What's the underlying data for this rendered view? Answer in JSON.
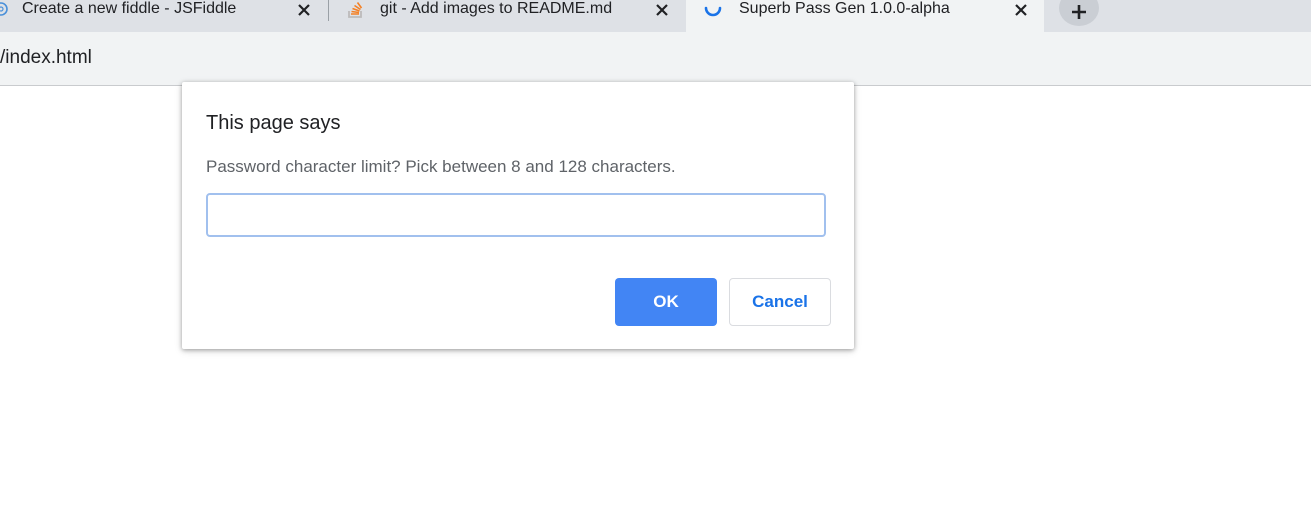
{
  "browser": {
    "tabs": [
      {
        "title": "Create a new fiddle - JSFiddle",
        "favicon": "jsfiddle-icon",
        "active": false
      },
      {
        "title": "git - Add images to README.md",
        "favicon": "stackoverflow-icon",
        "active": false
      },
      {
        "title": "Superb Pass Gen 1.0.0-alpha",
        "favicon": "loading-spinner-icon",
        "active": true
      }
    ],
    "close_glyph": "✕",
    "new_tab_glyph": "+",
    "address": "/index.html"
  },
  "dialog": {
    "title": "This page says",
    "message": "Password character limit? Pick between 8 and 128 characters.",
    "input_value": "",
    "ok_label": "OK",
    "cancel_label": "Cancel"
  },
  "colors": {
    "primary_button": "#4285f4",
    "cancel_text": "#1a73e8",
    "input_focus_border": "#a1c0ee"
  }
}
